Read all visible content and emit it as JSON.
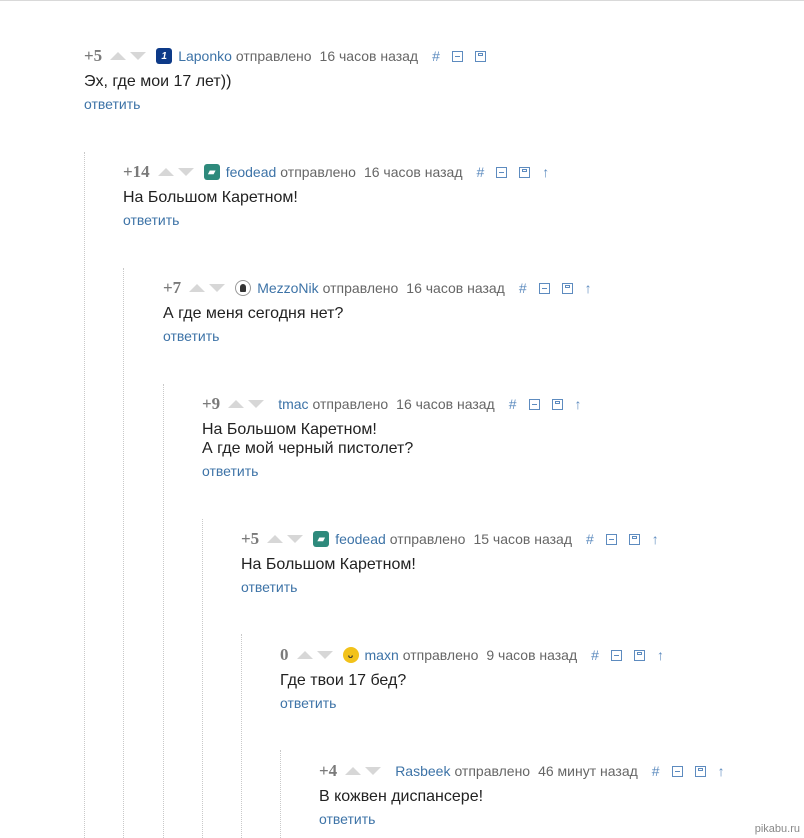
{
  "comments": [
    {
      "rating": "+5",
      "avatar": "1",
      "username": "Laponko",
      "sent": "отправлено",
      "time": "16 часов назад",
      "hash": "#",
      "arrow": "",
      "lines": [
        "Эх, где мои 17 лет))"
      ],
      "reply": "ответить"
    },
    {
      "rating": "+14",
      "avatar": "▰",
      "username": "feodead",
      "sent": "отправлено",
      "time": "16 часов назад",
      "hash": "#",
      "arrow": "↑",
      "lines": [
        "На Большом Каретном!"
      ],
      "reply": "ответить"
    },
    {
      "rating": "+7",
      "avatar": "",
      "username": "MezzoNik",
      "sent": "отправлено",
      "time": "16 часов назад",
      "hash": "#",
      "arrow": "↑",
      "lines": [
        "А где меня сегодня нет?"
      ],
      "reply": "ответить"
    },
    {
      "rating": "+9",
      "avatar": "",
      "username": "tmac",
      "sent": "отправлено",
      "time": "16 часов назад",
      "hash": "#",
      "arrow": "↑",
      "lines": [
        "На Большом Каретном!",
        "А где мой черный пистолет?"
      ],
      "reply": "ответить"
    },
    {
      "rating": "+5",
      "avatar": "▰",
      "username": "feodead",
      "sent": "отправлено",
      "time": "15 часов назад",
      "hash": "#",
      "arrow": "↑",
      "lines": [
        "На Большом Каретном!"
      ],
      "reply": "ответить"
    },
    {
      "rating": "0",
      "avatar": "ᴗ",
      "username": "maxn",
      "sent": "отправлено",
      "time": "9 часов назад",
      "hash": "#",
      "arrow": "↑",
      "lines": [
        "Где твои 17 бед?"
      ],
      "reply": "ответить"
    },
    {
      "rating": "+4",
      "avatar": "",
      "username": "Rasbeek",
      "sent": "отправлено",
      "time": "46 минут назад",
      "hash": "#",
      "arrow": "↑",
      "lines": [
        "В кожвен диспансере!"
      ],
      "reply": "ответить"
    }
  ],
  "watermark": "pikabu.ru"
}
